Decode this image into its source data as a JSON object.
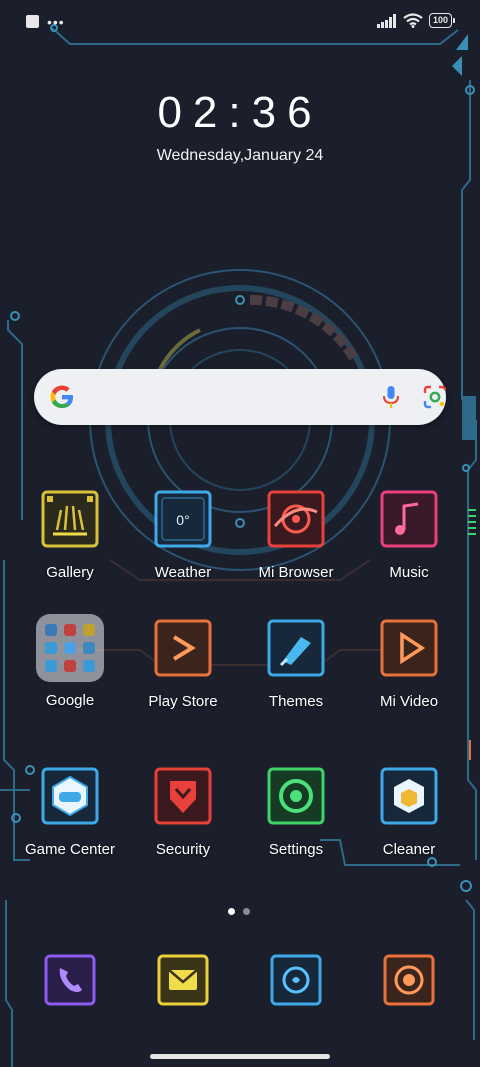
{
  "status_bar": {
    "battery": "100"
  },
  "clock": {
    "time": "02:36",
    "date": "Wednesday,January 24"
  },
  "search": {},
  "apps": [
    {
      "label": "Gallery"
    },
    {
      "label": "Weather",
      "icon_text": "0°"
    },
    {
      "label": "Mi Browser"
    },
    {
      "label": "Music"
    },
    {
      "label": "Google"
    },
    {
      "label": "Play Store"
    },
    {
      "label": "Themes"
    },
    {
      "label": "Mi Video"
    },
    {
      "label": "Game Center"
    },
    {
      "label": "Security"
    },
    {
      "label": "Settings"
    },
    {
      "label": "Cleaner"
    }
  ],
  "page_indicator": {
    "current_page": 1,
    "total_pages": 2
  },
  "dock": [
    {
      "icon": "phone-icon",
      "color": "#8a5cf0"
    },
    {
      "icon": "messaging-icon",
      "color": "#e8d13a"
    },
    {
      "icon": "camera-icon",
      "color": "#3fa9e8"
    },
    {
      "icon": "camera-shutter-icon",
      "color": "#e8703a"
    }
  ],
  "colors": {
    "background": "#1b1e2b",
    "circuit": "#2f6a8a",
    "gallery": "#d9c23a",
    "weather": "#3fa9e8",
    "browser": "#e8403a",
    "music": "#e8407a",
    "playstore": "#e8703a",
    "themes": "#3fa9e8",
    "video": "#e8703a",
    "gamecenter": "#3fa9e8",
    "security": "#e8403a",
    "settings": "#3fd36a",
    "cleaner": "#3fa9e8"
  }
}
